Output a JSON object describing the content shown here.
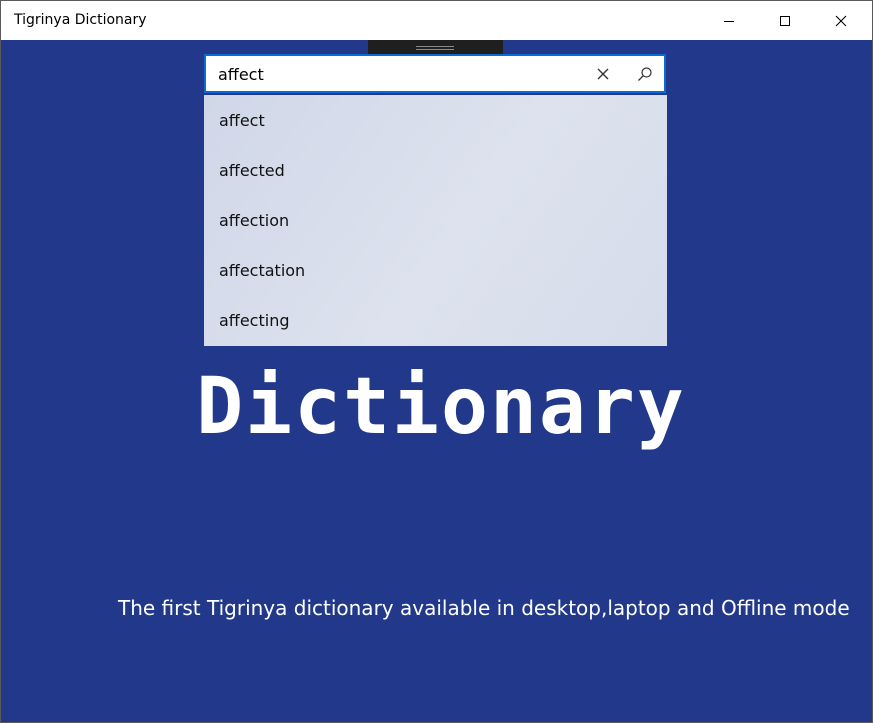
{
  "window": {
    "title": "Tigrinya Dictionary",
    "controls": [
      "minimize-icon",
      "maximize-icon",
      "close-icon"
    ]
  },
  "search": {
    "value": "affect",
    "clear_icon": "close-icon",
    "search_icon": "search-icon"
  },
  "suggestions": [
    "affect",
    "affected",
    "affection",
    "affectation",
    "affecting"
  ],
  "main": {
    "heading": "Dictionary",
    "tagline": "The first Tigrinya dictionary available in desktop,laptop and Offline mode"
  },
  "colors": {
    "background": "#22388b",
    "accent": "#0a6bd6",
    "text": "#ffffff"
  }
}
